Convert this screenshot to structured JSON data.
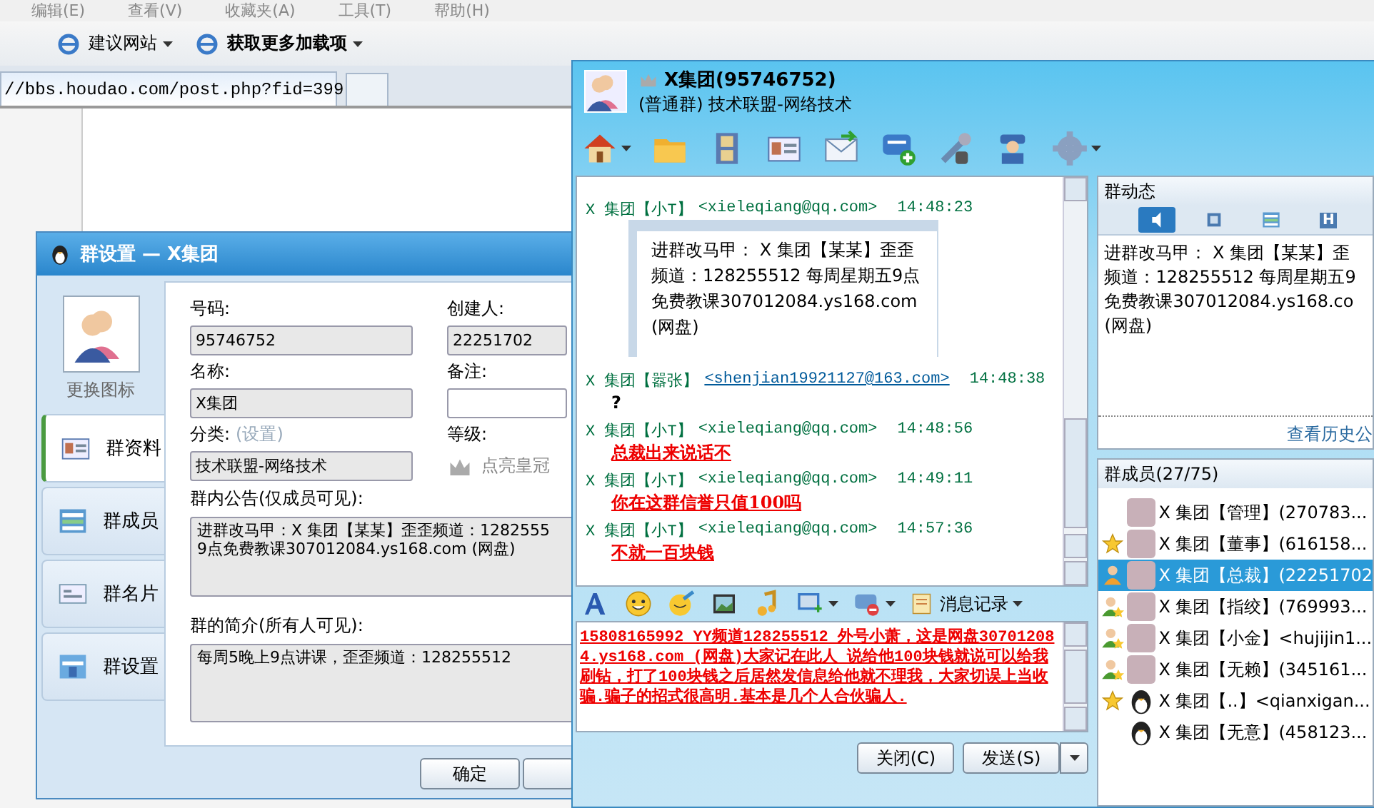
{
  "browser": {
    "menu": [
      "编辑(E)",
      "查看(V)",
      "收藏夹(A)",
      "工具(T)",
      "帮助(H)"
    ],
    "favorites": [
      {
        "label": "建议网站",
        "bold": false,
        "dropdown": true
      },
      {
        "label": "获取更多加载项",
        "bold": true,
        "dropdown": true
      }
    ],
    "address": "//bbs.houdao.com/post.php?fid=399"
  },
  "settings_dialog": {
    "title": "群设置 — X集团",
    "change_icon": "更换图标",
    "nav": [
      {
        "label": "群资料",
        "kind": "card",
        "selected": true
      },
      {
        "label": "群成员",
        "kind": "list",
        "selected": false
      },
      {
        "label": "群名片",
        "kind": "namecard",
        "selected": false
      },
      {
        "label": "群设置",
        "kind": "settings",
        "selected": false
      }
    ],
    "number_label": "号码:",
    "number": "95746752",
    "creator_label": "创建人:",
    "creator": "22251702",
    "name_label": "名称:",
    "name": "X集团",
    "remark_label": "备注:",
    "category_label": "分类:",
    "category_link": "(设置)",
    "category": "技术联盟-网络技术",
    "level_label": "等级:",
    "level_action": "点亮皇冠",
    "announcement_label": "群内公告(仅成员可见):",
    "announcement": [
      "进群改马甲：X 集团【某某】歪歪频道：1282555",
      "9点免费教课307012084.ys168.com (网盘)"
    ],
    "intro_label": "群的简介(所有人可见):",
    "intro": "每周5晚上9点讲课，歪歪频道：128255512",
    "buttons": [
      "确定"
    ]
  },
  "chat_window": {
    "title": "X集团(95746752)",
    "subtitle": "(普通群) 技术联盟-网络技术",
    "toolbar": [
      {
        "kind": "home",
        "dropdown": true
      },
      {
        "kind": "folder",
        "dropdown": false
      },
      {
        "kind": "film",
        "dropdown": false
      },
      {
        "kind": "card",
        "dropdown": false
      },
      {
        "kind": "mail",
        "dropdown": false
      },
      {
        "kind": "chat-add",
        "dropdown": false
      },
      {
        "kind": "tools",
        "dropdown": false
      },
      {
        "kind": "person",
        "dropdown": false
      },
      {
        "kind": "gear",
        "dropdown": true
      }
    ],
    "messages": [
      {
        "sender": "X 集团【小T】",
        "email": "<xieleqiang@qq.com>",
        "link": false,
        "time": "14:48:23",
        "kind": "card",
        "lines": [
          "进群改马甲： X 集团【某某】歪歪",
          "频道：128255512 每周星期五9点",
          "免费教课307012084.ys168.com",
          "(网盘)"
        ]
      },
      {
        "sender": "X 集团【嚣张】",
        "email": "<shenjian19921127@163.com>",
        "link": true,
        "time": "14:48:38",
        "kind": "plain",
        "lines": [
          "?"
        ]
      },
      {
        "sender": "X 集团【小T】",
        "email": "<xieleqiang@qq.com>",
        "link": false,
        "time": "14:48:56",
        "kind": "red",
        "lines": [
          "总裁出来说话不"
        ]
      },
      {
        "sender": "X 集团【小T】",
        "email": "<xieleqiang@qq.com>",
        "link": false,
        "time": "14:49:11",
        "kind": "red",
        "lines": [
          "你在这群信誉只值100吗"
        ]
      },
      {
        "sender": "X 集团【小T】",
        "email": "<xieleqiang@qq.com>",
        "link": false,
        "time": "14:57:36",
        "kind": "red",
        "lines": [
          "不就一百块钱"
        ]
      }
    ],
    "input_toolbar": [
      {
        "kind": "font",
        "dropdown": false
      },
      {
        "kind": "smiley",
        "dropdown": false
      },
      {
        "kind": "face-brush",
        "dropdown": false
      },
      {
        "kind": "picture",
        "dropdown": false
      },
      {
        "kind": "music",
        "dropdown": false
      },
      {
        "kind": "screen",
        "dropdown": true
      },
      {
        "kind": "chat-block",
        "dropdown": true
      }
    ],
    "history_button": "消息记录",
    "input_text": "15808165992 YY频道128255512 外号小萧，这是网盘307012084.ys168.com (网盘)大家记在此人  说给他100块钱就说可以给我刷钻，打了100块钱之后居然发信息给他就不理我，大家切误上当收骗.骗子的招式很高明.基本是几个人合伙骗人.",
    "buttons": [
      {
        "label": "关闭(C)",
        "dropdown": false
      },
      {
        "label": "发送(S)",
        "dropdown": true
      }
    ],
    "notice": {
      "title": "群动态",
      "tabs": [
        {
          "kind": "speaker",
          "selected": true
        },
        {
          "kind": "square",
          "selected": false
        },
        {
          "kind": "list",
          "selected": false
        },
        {
          "kind": "letter",
          "label": "H",
          "selected": false
        }
      ],
      "lines": [
        "进群改马甲： X 集团【某某】歪",
        "频道：128255512 每周星期五9",
        "免费教课307012084.ys168.co",
        "(网盘)"
      ],
      "history_link": "查看历史公"
    },
    "members": {
      "title": "群成员(27/75)",
      "items": [
        {
          "kind": "plain",
          "name": "X 集团【管理】(270783...",
          "selected": false
        },
        {
          "kind": "star",
          "name": "X 集团【董事】(616158...",
          "selected": false
        },
        {
          "kind": "owner",
          "name": "X 集团【总裁】(22251702",
          "selected": true
        },
        {
          "kind": "admin",
          "name": "X 集团【指绞】(769993...",
          "selected": false
        },
        {
          "kind": "admin",
          "name": "X 集团【小金】<hujijin1...",
          "selected": false
        },
        {
          "kind": "admin",
          "name": "X 集团【无赖】(345161...",
          "selected": false
        },
        {
          "kind": "star",
          "name": "X 集团【..】<qianxigan...",
          "selected": false,
          "default_avatar": true
        },
        {
          "kind": "plain",
          "name": "X 集团【无意】(458123...",
          "selected": false,
          "default_avatar": true
        }
      ]
    }
  }
}
